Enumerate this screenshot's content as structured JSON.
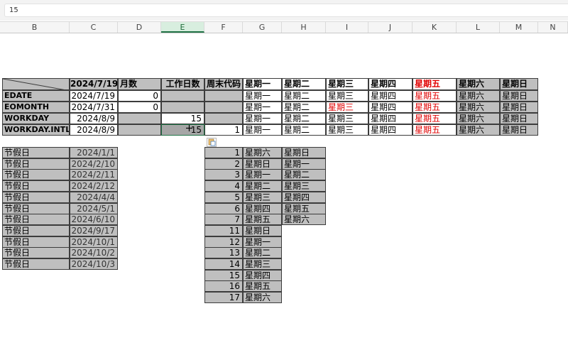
{
  "formula_bar": {
    "value": "15"
  },
  "columns": [
    "B",
    "C",
    "D",
    "E",
    "F",
    "G",
    "H",
    "I",
    "J",
    "K",
    "L",
    "M",
    "N"
  ],
  "selected_column": "E",
  "top_table": {
    "header": {
      "date": "2024/7/19",
      "months": "月数",
      "workdays": "工作日数",
      "weekend_code": "周末代码",
      "weekdays": [
        "星期一",
        "星期二",
        "星期三",
        "星期四",
        "星期五",
        "星期六",
        "星期日"
      ]
    },
    "rows": [
      {
        "fn": "EDATE",
        "date": "2024/7/19",
        "months": "0",
        "workdays": "",
        "weekend_code": "",
        "weekdays": [
          "星期一",
          "星期二",
          "星期三",
          "星期四",
          "星期五",
          "星期六",
          "星期日"
        ],
        "red_index": 4
      },
      {
        "fn": "EOMONTH",
        "date": "2024/7/31",
        "months": "0",
        "workdays": "",
        "weekend_code": "",
        "weekdays": [
          "星期一",
          "星期二",
          "星期三",
          "星期四",
          "星期五",
          "星期六",
          "星期日"
        ],
        "red_index": [
          2,
          4
        ]
      },
      {
        "fn": "WORKDAY",
        "date": "2024/8/9",
        "months": "",
        "workdays": "15",
        "weekend_code": "",
        "weekdays": [
          "星期一",
          "星期二",
          "星期三",
          "星期四",
          "星期五",
          "星期六",
          "星期日"
        ],
        "red_index": 4
      },
      {
        "fn": "WORKDAY.INTL",
        "date": "2024/8/9",
        "months": "",
        "workdays": "15",
        "weekend_code": "1",
        "weekdays": [
          "星期一",
          "星期二",
          "星期三",
          "星期四",
          "星期五",
          "星期六",
          "星期日"
        ],
        "red_index": 4
      }
    ]
  },
  "holidays": {
    "label": "节假日",
    "dates": [
      "2024/1/1",
      "2024/2/10",
      "2024/2/11",
      "2024/2/12",
      "2024/4/4",
      "2024/5/1",
      "2024/6/10",
      "2024/9/17",
      "2024/10/1",
      "2024/10/2",
      "2024/10/3"
    ]
  },
  "weekend_codes": [
    {
      "code": "1",
      "days": [
        "星期六",
        "星期日"
      ]
    },
    {
      "code": "2",
      "days": [
        "星期日",
        "星期一"
      ]
    },
    {
      "code": "3",
      "days": [
        "星期一",
        "星期二"
      ]
    },
    {
      "code": "4",
      "days": [
        "星期二",
        "星期三"
      ]
    },
    {
      "code": "5",
      "days": [
        "星期三",
        "星期四"
      ]
    },
    {
      "code": "6",
      "days": [
        "星期四",
        "星期五"
      ]
    },
    {
      "code": "7",
      "days": [
        "星期五",
        "星期六"
      ]
    },
    {
      "code": "11",
      "days": [
        "星期日"
      ]
    },
    {
      "code": "12",
      "days": [
        "星期一"
      ]
    },
    {
      "code": "13",
      "days": [
        "星期二"
      ]
    },
    {
      "code": "14",
      "days": [
        "星期三"
      ]
    },
    {
      "code": "15",
      "days": [
        "星期四"
      ]
    },
    {
      "code": "16",
      "days": [
        "星期五"
      ]
    },
    {
      "code": "17",
      "days": [
        "星期六"
      ]
    }
  ],
  "colors": {
    "cell_fill": "#bfbfbf",
    "selected": "#217346",
    "red_text": "#e00000"
  }
}
